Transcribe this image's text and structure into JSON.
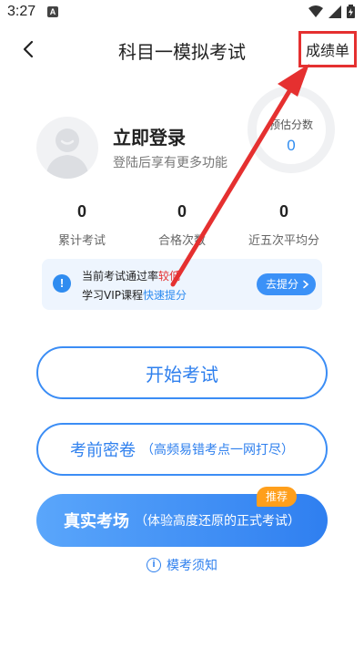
{
  "status_bar": {
    "time": "3:27",
    "notif_glyph": "A"
  },
  "header": {
    "title": "科目一模拟考试",
    "score_button": "成绩单"
  },
  "profile": {
    "login_title": "立即登录",
    "login_subtitle": "登陆后享有更多功能"
  },
  "estimated_score": {
    "label": "预估分数",
    "value": "0"
  },
  "stats": [
    {
      "value": "0",
      "label": "累计考试"
    },
    {
      "value": "0",
      "label": "合格次数"
    },
    {
      "value": "0",
      "label": "近五次平均分"
    }
  ],
  "tip": {
    "line1_prefix": "当前考试通过率",
    "line1_highlight": "较低",
    "line2_prefix": "学习VIP课程",
    "line2_link": "快速提分",
    "button": "去提分"
  },
  "buttons": {
    "start": "开始考试",
    "secret_main": "考前密卷",
    "secret_sub": "（高频易错考点一网打尽）",
    "real_main": "真实考场",
    "real_sub": "（体验高度还原的正式考试）",
    "recommend_badge": "推荐"
  },
  "notice": "模考须知",
  "colors": {
    "accent": "#2f80ee",
    "highlight_red": "#e53030",
    "badge_orange": "#ff9f1c",
    "annotation_red": "#e53030"
  }
}
